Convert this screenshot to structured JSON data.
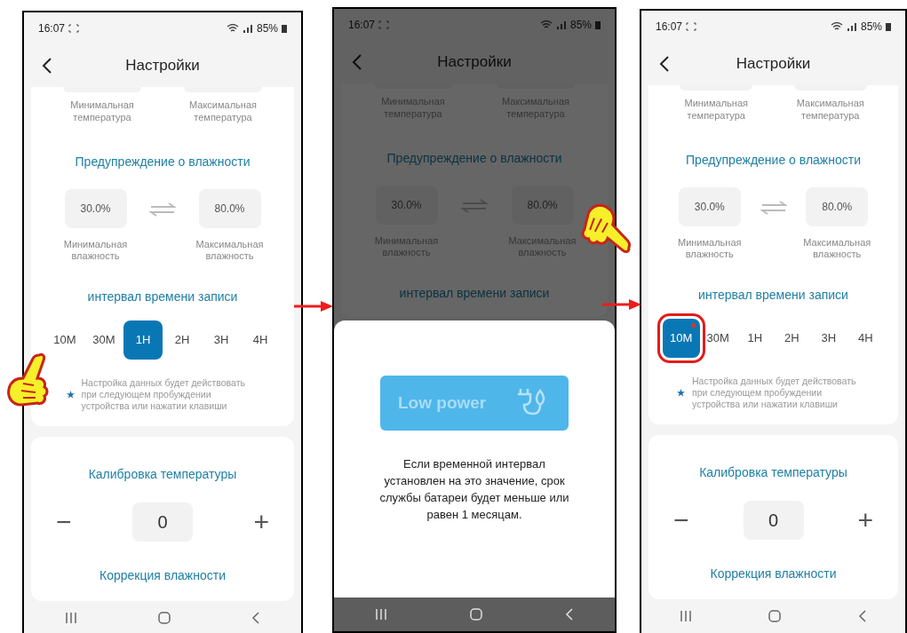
{
  "phones": [
    {
      "status_bar": {
        "time": "16:07",
        "battery": "85%"
      },
      "title": "Настройки",
      "dimmed": false,
      "temperature": {
        "min_label": "Минимальная температура",
        "max_label": "Максимальная температура"
      },
      "humidity": {
        "heading": "Предупреждение о влажности",
        "min_value": "30.0%",
        "max_value": "80.0%",
        "min_label": "Минимальная влажность",
        "max_label": "Максимальная влажность"
      },
      "interval": {
        "heading": "интервал времени записи",
        "options": [
          {
            "label": "10M",
            "selected": false,
            "highlighted": false
          },
          {
            "label": "30M",
            "selected": false,
            "highlighted": false
          },
          {
            "label": "1H",
            "selected": true,
            "highlighted": false
          },
          {
            "label": "2H",
            "selected": false,
            "highlighted": false
          },
          {
            "label": "3H",
            "selected": false,
            "highlighted": false
          },
          {
            "label": "4H",
            "selected": false,
            "highlighted": false
          }
        ],
        "note": "Настройка данных будет действовать при следующем пробуждении устройства или нажатии клавиши"
      },
      "calibration": {
        "heading": "Калибровка температуры",
        "value": "0",
        "minus": "−",
        "plus": "+",
        "next_heading": "Коррекция влажности"
      }
    },
    {
      "status_bar": {
        "time": "16:07",
        "battery": "85%"
      },
      "title": "Настройки",
      "dimmed": true,
      "temperature": {
        "min_label": "Минимальная температура",
        "max_label": "Максимальная температура"
      },
      "humidity": {
        "heading": "Предупреждение о влажности",
        "min_value": "30.0%",
        "max_value": "80.0%",
        "min_label": "Минимальная влажность",
        "max_label": "Максимальная влажность"
      },
      "interval": {
        "heading": "интервал времени записи"
      },
      "sheet": {
        "banner_text": "Low power",
        "message": "Если временной интервал установлен на это значение, срок службы батареи будет меньше или равен 1 месяцам."
      }
    },
    {
      "status_bar": {
        "time": "16:07",
        "battery": "85%"
      },
      "title": "Настройки",
      "dimmed": false,
      "temperature": {
        "min_label": "Минимальная температура",
        "max_label": "Максимальная температура"
      },
      "humidity": {
        "heading": "Предупреждение о влажности",
        "min_value": "30.0%",
        "max_value": "80.0%",
        "min_label": "Минимальная влажность",
        "max_label": "Максимальная влажность"
      },
      "interval": {
        "heading": "интервал времени записи",
        "options": [
          {
            "label": "10M",
            "selected": true,
            "highlighted": true
          },
          {
            "label": "30M",
            "selected": false,
            "highlighted": false
          },
          {
            "label": "1H",
            "selected": false,
            "highlighted": false
          },
          {
            "label": "2H",
            "selected": false,
            "highlighted": false
          },
          {
            "label": "3H",
            "selected": false,
            "highlighted": false
          },
          {
            "label": "4H",
            "selected": false,
            "highlighted": false
          }
        ],
        "note": "Настройка данных будет действовать при следующем пробуждении устройства или нажатии клавиши"
      },
      "calibration": {
        "heading": "Калибровка температуры",
        "value": "0",
        "minus": "−",
        "plus": "+",
        "next_heading": "Коррекция влажности"
      }
    }
  ]
}
